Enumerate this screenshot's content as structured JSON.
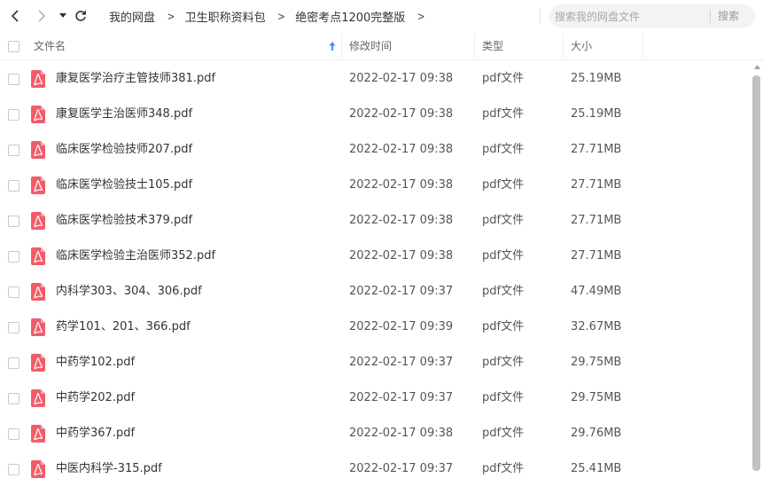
{
  "nav": {
    "back_label": "back",
    "forward_label": "forward",
    "history_label": "history",
    "refresh_label": "refresh"
  },
  "breadcrumb": {
    "items": [
      {
        "label": "我的网盘"
      },
      {
        "label": "卫生职称资料包"
      },
      {
        "label": "绝密考点1200完整版"
      }
    ],
    "separator": ">"
  },
  "search": {
    "placeholder": "搜索我的网盘文件",
    "button_label": "搜索"
  },
  "columns": {
    "name": "文件名",
    "modified": "修改时间",
    "type": "类型",
    "size": "大小"
  },
  "sort": {
    "column": "name",
    "direction": "ascending"
  },
  "colors": {
    "pdf_icon": "#f25c69",
    "text": "#333333",
    "sort_arrow": "#3b8ff6",
    "scroll_thumb": "#c1c1c1"
  },
  "files": [
    {
      "name": "康复医学治疗主管技师381.pdf",
      "modified": "2022-02-17 09:38",
      "type": "pdf文件",
      "size": "25.19MB",
      "icon": "pdf-icon"
    },
    {
      "name": "康复医学主治医师348.pdf",
      "modified": "2022-02-17 09:38",
      "type": "pdf文件",
      "size": "25.19MB",
      "icon": "pdf-icon"
    },
    {
      "name": "临床医学检验技师207.pdf",
      "modified": "2022-02-17 09:38",
      "type": "pdf文件",
      "size": "27.71MB",
      "icon": "pdf-icon"
    },
    {
      "name": "临床医学检验技士105.pdf",
      "modified": "2022-02-17 09:38",
      "type": "pdf文件",
      "size": "27.71MB",
      "icon": "pdf-icon"
    },
    {
      "name": "临床医学检验技术379.pdf",
      "modified": "2022-02-17 09:38",
      "type": "pdf文件",
      "size": "27.71MB",
      "icon": "pdf-icon"
    },
    {
      "name": "临床医学检验主治医师352.pdf",
      "modified": "2022-02-17 09:38",
      "type": "pdf文件",
      "size": "27.71MB",
      "icon": "pdf-icon"
    },
    {
      "name": "内科学303、304、306.pdf",
      "modified": "2022-02-17 09:37",
      "type": "pdf文件",
      "size": "47.49MB",
      "icon": "pdf-icon"
    },
    {
      "name": "药学101、201、366.pdf",
      "modified": "2022-02-17 09:39",
      "type": "pdf文件",
      "size": "32.67MB",
      "icon": "pdf-icon"
    },
    {
      "name": "中药学102.pdf",
      "modified": "2022-02-17 09:37",
      "type": "pdf文件",
      "size": "29.75MB",
      "icon": "pdf-icon"
    },
    {
      "name": "中药学202.pdf",
      "modified": "2022-02-17 09:37",
      "type": "pdf文件",
      "size": "29.75MB",
      "icon": "pdf-icon"
    },
    {
      "name": "中药学367.pdf",
      "modified": "2022-02-17 09:38",
      "type": "pdf文件",
      "size": "29.76MB",
      "icon": "pdf-icon"
    },
    {
      "name": "中医内科学-315.pdf",
      "modified": "2022-02-17 09:37",
      "type": "pdf文件",
      "size": "25.41MB",
      "icon": "pdf-icon"
    }
  ]
}
